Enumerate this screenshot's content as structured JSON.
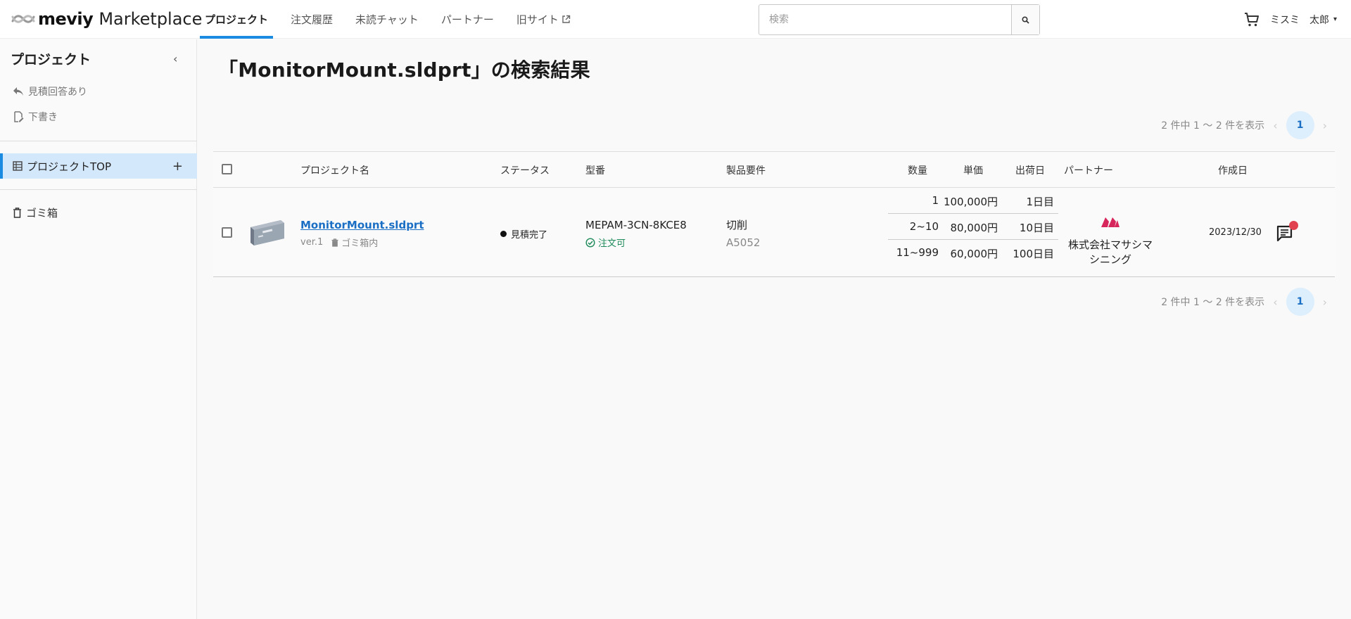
{
  "header": {
    "brand": "meviy",
    "brand_suffix": "Marketplace",
    "nav": [
      {
        "label": "プロジェクト"
      },
      {
        "label": "注文履歴"
      },
      {
        "label": "未読チャット"
      },
      {
        "label": "パートナー"
      },
      {
        "label": "旧サイト"
      }
    ],
    "search_placeholder": "検索",
    "user_last": "ミスミ",
    "user_first": "太郎"
  },
  "sidebar": {
    "title": "プロジェクト",
    "quote_answered": "見積回答あり",
    "drafts": "下書き",
    "project_top": "プロジェクトTOP",
    "trash": "ゴミ箱"
  },
  "main": {
    "title": "「MonitorMount.sldprt」の検索結果",
    "pager_text": "2 件中 1 〜 2 件を表示",
    "current_page": "1",
    "columns": {
      "name": "プロジェクト名",
      "status": "ステータス",
      "model": "型番",
      "requirements": "製品要件",
      "qty": "数量",
      "unit_price": "単価",
      "ship_day": "出荷日",
      "partner": "パートナー",
      "created": "作成日"
    },
    "rows": [
      {
        "file_name": "MonitorMount.sldprt",
        "version": "ver.1",
        "trash_label": "ゴミ箱内",
        "status": "見積完了",
        "model_number": "MEPAM-3CN-8KCE8",
        "orderable": "注文可",
        "process": "切削",
        "material": "A5052",
        "prices": [
          {
            "qty": "1",
            "price": "100,000円",
            "ship": "1日目"
          },
          {
            "qty": "2~10",
            "price": "80,000円",
            "ship": "10日目"
          },
          {
            "qty": "11~999",
            "price": "60,000円",
            "ship": "100日目"
          }
        ],
        "partner_name": "株式会社マサシマシニング",
        "created": "2023/12/30"
      }
    ]
  },
  "colors": {
    "accent": "#1a8be0",
    "link": "#1a6fc4",
    "orderable": "#1e8a5a",
    "partner_logo": "#d6265c",
    "badge": "#e0424f"
  }
}
